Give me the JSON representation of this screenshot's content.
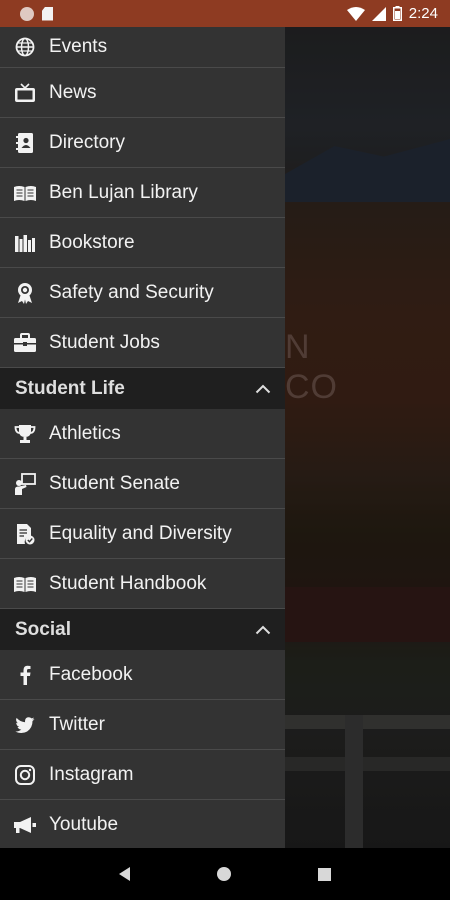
{
  "status_bar": {
    "time": "2:24",
    "icons": [
      "notification-dot-icon",
      "sd-card-icon",
      "wifi-icon",
      "signal-icon",
      "battery-icon"
    ]
  },
  "background": {
    "partial_text_line1": "N",
    "partial_text_line2": "CO"
  },
  "drawer": {
    "top_items": [
      {
        "label": "Events",
        "icon": "globe-icon"
      },
      {
        "label": "News",
        "icon": "tv-icon"
      },
      {
        "label": "Directory",
        "icon": "contacts-book-icon"
      },
      {
        "label": "Ben Lujan Library",
        "icon": "open-book-icon"
      },
      {
        "label": "Bookstore",
        "icon": "books-icon"
      },
      {
        "label": "Safety and Security",
        "icon": "badge-ribbon-icon"
      },
      {
        "label": "Student Jobs",
        "icon": "briefcase-icon"
      }
    ],
    "sections": [
      {
        "title": "Student Life",
        "items": [
          {
            "label": "Athletics",
            "icon": "trophy-icon"
          },
          {
            "label": "Student Senate",
            "icon": "presenter-icon"
          },
          {
            "label": "Equality and Diversity",
            "icon": "document-check-icon"
          },
          {
            "label": "Student Handbook",
            "icon": "open-book-icon"
          }
        ]
      },
      {
        "title": "Social",
        "items": [
          {
            "label": "Facebook",
            "icon": "facebook-icon"
          },
          {
            "label": "Twitter",
            "icon": "twitter-icon"
          },
          {
            "label": "Instagram",
            "icon": "instagram-icon"
          },
          {
            "label": "Youtube",
            "icon": "megaphone-icon"
          }
        ]
      }
    ]
  },
  "colors": {
    "status_bar": "#8e3b22",
    "drawer_bg": "#333333",
    "section_bg": "#1f1f1f",
    "text": "#f2f2f2"
  }
}
